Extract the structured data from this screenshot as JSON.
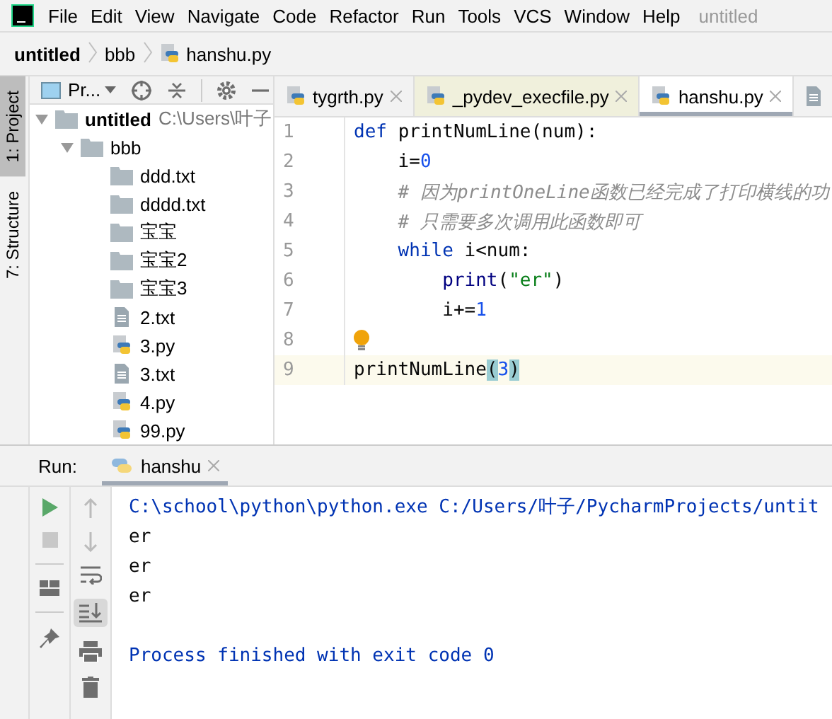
{
  "menu": [
    "File",
    "Edit",
    "View",
    "Navigate",
    "Code",
    "Refactor",
    "Run",
    "Tools",
    "VCS",
    "Window",
    "Help"
  ],
  "window": {
    "title": "untitled"
  },
  "breadcrumb": [
    {
      "label": "untitled",
      "kind": "project"
    },
    {
      "label": "bbb",
      "kind": "folder"
    },
    {
      "label": "hanshu.py",
      "kind": "py"
    }
  ],
  "tool_strip": [
    {
      "label": "1: Project",
      "selected": true
    },
    {
      "label": "7: Structure",
      "selected": false
    }
  ],
  "project_panel": {
    "title": "Pr...",
    "tree": [
      {
        "label": "untitled",
        "path": "C:\\Users\\叶子",
        "kind": "folder",
        "expanded": true,
        "children": [
          {
            "label": "bbb",
            "kind": "folder",
            "expanded": true,
            "children": [
              {
                "label": "ddd.txt",
                "kind": "folder"
              },
              {
                "label": "dddd.txt",
                "kind": "folder"
              },
              {
                "label": "宝宝",
                "kind": "folder"
              },
              {
                "label": "宝宝2",
                "kind": "folder"
              },
              {
                "label": "宝宝3",
                "kind": "folder"
              },
              {
                "label": "2.txt",
                "kind": "txt"
              },
              {
                "label": "3.py",
                "kind": "py"
              },
              {
                "label": "3.txt",
                "kind": "txt"
              },
              {
                "label": "4.py",
                "kind": "py"
              },
              {
                "label": "99.py",
                "kind": "py"
              }
            ]
          }
        ]
      }
    ]
  },
  "editor_tabs": [
    {
      "label": "tygrth.py",
      "kind": "py",
      "selected": false,
      "highlighted": false
    },
    {
      "label": "_pydev_execfile.py",
      "kind": "py",
      "selected": false,
      "highlighted": true
    },
    {
      "label": "hanshu.py",
      "kind": "py",
      "selected": true,
      "highlighted": false
    },
    {
      "kind": "txt",
      "selected": false,
      "highlighted": false
    }
  ],
  "code": [
    {
      "number": "1",
      "tokens": [
        {
          "text": "def ",
          "kind": "keyword"
        },
        {
          "text": "printNumLine(num):",
          "kind": "plain"
        }
      ]
    },
    {
      "number": "2",
      "tokens": [
        {
          "text": "    i=",
          "kind": "plain"
        },
        {
          "text": "0",
          "kind": "number"
        }
      ]
    },
    {
      "number": "3",
      "tokens": [
        {
          "text": "    # 因为printOneLine函数已经完成了打印横线的功",
          "kind": "comment"
        }
      ]
    },
    {
      "number": "4",
      "tokens": [
        {
          "text": "    # 只需要多次调用此函数即可",
          "kind": "comment"
        }
      ]
    },
    {
      "number": "5",
      "tokens": [
        {
          "text": "    while ",
          "kind": "keyword"
        },
        {
          "text": "i<num:",
          "kind": "plain"
        }
      ]
    },
    {
      "number": "6",
      "tokens": [
        {
          "text": "        print",
          "kind": "builtin"
        },
        {
          "text": "(",
          "kind": "plain"
        },
        {
          "text": "\"er\"",
          "kind": "string"
        },
        {
          "text": ")",
          "kind": "plain"
        }
      ]
    },
    {
      "number": "7",
      "tokens": [
        {
          "text": "        i+=",
          "kind": "plain"
        },
        {
          "text": "1",
          "kind": "number"
        }
      ]
    },
    {
      "number": "8",
      "bulb": true
    },
    {
      "number": "9",
      "current": true,
      "tokens": [
        {
          "text": "printNumLine",
          "kind": "plain"
        },
        {
          "text": "(",
          "kind": "brace"
        },
        {
          "text": "3",
          "kind": "number"
        },
        {
          "text": ")",
          "kind": "brace"
        }
      ]
    }
  ],
  "run_panel": {
    "title": "Run:",
    "tab": "hanshu",
    "console": [
      {
        "text": "C:\\school\\python\\python.exe C:/Users/叶子/PycharmProjects/untit",
        "kind": "command"
      },
      {
        "text": "er",
        "kind": "output"
      },
      {
        "text": "er",
        "kind": "output"
      },
      {
        "text": "er",
        "kind": "output"
      },
      {
        "text": "Process finished with exit code 0",
        "kind": "exit"
      }
    ]
  }
}
